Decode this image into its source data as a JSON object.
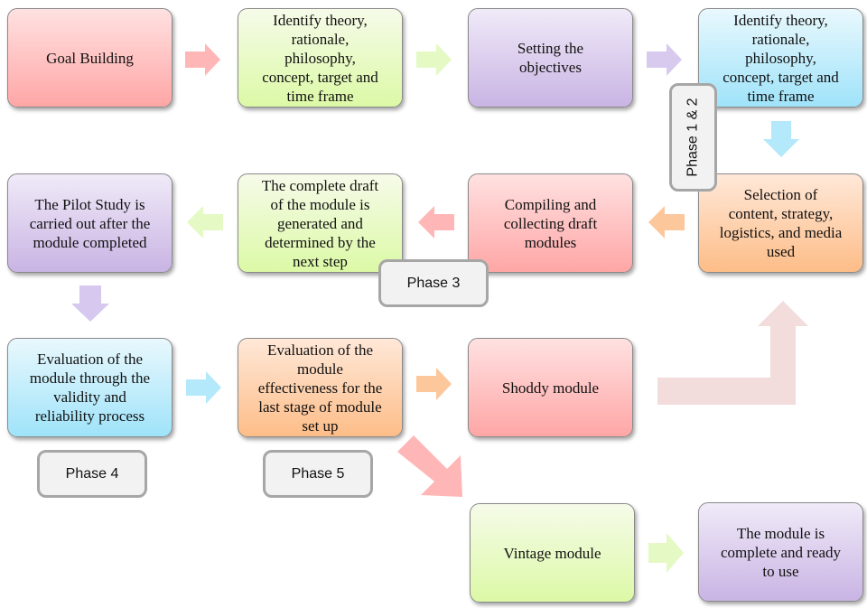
{
  "diagram": {
    "steps": [
      {
        "id": "goal-building",
        "lines": [
          "Goal Building"
        ]
      },
      {
        "id": "identify-theory-1",
        "lines": [
          "Identify theory,",
          "rationale,",
          "philosophy,",
          "concept, target and",
          "time frame"
        ]
      },
      {
        "id": "setting-objectives",
        "lines": [
          "Setting the",
          "objectives"
        ]
      },
      {
        "id": "identify-theory-2",
        "lines": [
          "Identify theory,",
          "rationale,",
          "philosophy,",
          "concept, target and",
          "time frame"
        ]
      },
      {
        "id": "selection-of-content",
        "lines": [
          "Selection of",
          "content, strategy,",
          "logistics, and media",
          "used"
        ]
      },
      {
        "id": "compiling-drafts",
        "lines": [
          "Compiling and",
          "collecting draft",
          "modules"
        ]
      },
      {
        "id": "complete-draft",
        "lines": [
          "The complete draft",
          "of the module is",
          "generated and",
          "determined by the",
          "next step"
        ]
      },
      {
        "id": "pilot-study",
        "lines": [
          "The Pilot Study is",
          "carried out after the",
          "module completed"
        ]
      },
      {
        "id": "evaluation-validity",
        "lines": [
          "Evaluation of the",
          "module through the",
          "validity and",
          "reliability process"
        ]
      },
      {
        "id": "evaluation-effectiveness",
        "lines": [
          "Evaluation of the",
          "module",
          "effectiveness for the",
          "last stage of module",
          "set up"
        ]
      },
      {
        "id": "shoddy-module",
        "lines": [
          "Shoddy module"
        ]
      },
      {
        "id": "vintage-module",
        "lines": [
          "Vintage module"
        ]
      },
      {
        "id": "module-complete",
        "lines": [
          "The module is",
          "complete and ready",
          "to use"
        ]
      }
    ],
    "phases": [
      {
        "id": "phase-1-2",
        "label": "Phase 1 & 2"
      },
      {
        "id": "phase-3",
        "label": "Phase 3"
      },
      {
        "id": "phase-4",
        "label": "Phase 4"
      },
      {
        "id": "phase-5",
        "label": "Phase 5"
      }
    ],
    "colors": {
      "red_arrow": "#ffb3b3",
      "green_arrow": "#e4f9c2",
      "purple_arrow": "#d6c8ee",
      "blue_arrow": "#b4e8fb",
      "orange_arrow": "#fdc79c",
      "feedback_arrow": "#f2dcdc"
    }
  }
}
